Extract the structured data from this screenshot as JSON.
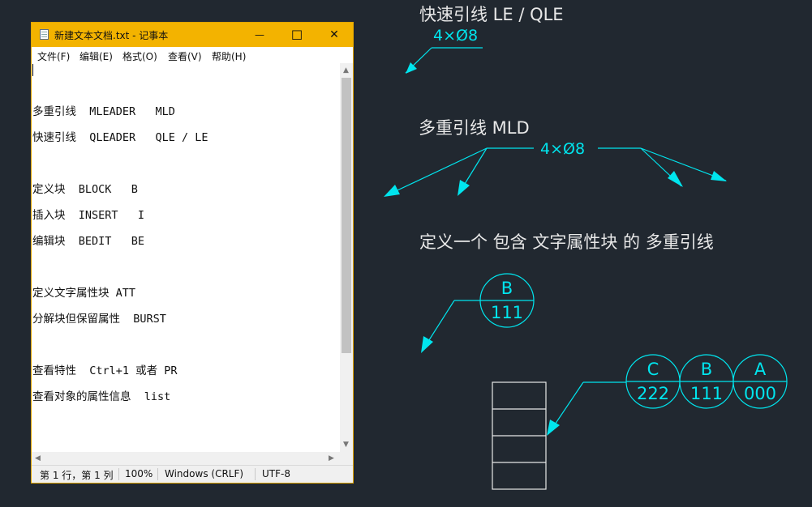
{
  "window": {
    "title": "新建文本文档.txt - 记事本",
    "icon": "notepad-icon",
    "controls": {
      "minimize": "—",
      "maximize": "☐",
      "close": "✕"
    }
  },
  "menu": [
    "文件(F)",
    "编辑(E)",
    "格式(O)",
    "查看(V)",
    "帮助(H)"
  ],
  "editor_lines": [
    "",
    "",
    "多重引线  MLEADER   MLD",
    "快速引线  QLEADER   QLE / LE",
    "",
    "定义块  BLOCK   B",
    "插入块  INSERT   I",
    "编辑块  BEDIT   BE",
    "",
    "定义文字属性块 ATT",
    "分解块但保留属性  BURST",
    "",
    "查看特性  Ctrl+1 或者 PR",
    "查看对象的属性信息  list"
  ],
  "status": {
    "position": "第 1 行，第 1 列",
    "zoom": "100%",
    "line_ending": "Windows (CRLF)",
    "encoding": "UTF-8"
  },
  "canvas": {
    "label_qle": "快速引线  LE / QLE",
    "dim_qle": "4×Ø8",
    "label_mld": "多重引线  MLD",
    "dim_mld": "4×Ø8",
    "label_block": "定义一个  包含  文字属性块  的  多重引线",
    "bubble_single": {
      "tag": "B",
      "value": "111"
    },
    "bubbles": [
      {
        "tag": "C",
        "value": "222"
      },
      {
        "tag": "B",
        "value": "111"
      },
      {
        "tag": "A",
        "value": "000"
      }
    ]
  },
  "colors": {
    "background": "#212830",
    "cad_text": "#e8e8e8",
    "leader": "#00e5ee",
    "titlebar": "#f3b300"
  }
}
